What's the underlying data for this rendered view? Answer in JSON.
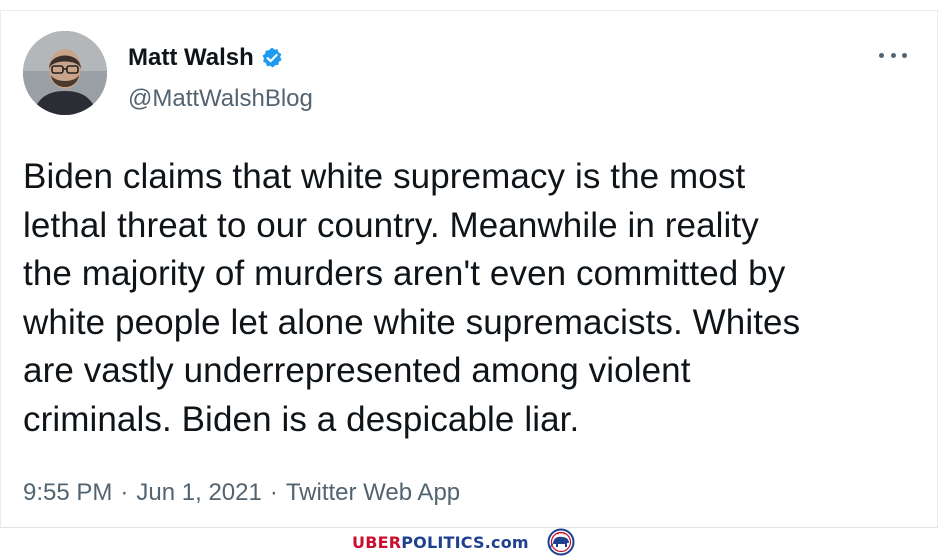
{
  "tweet": {
    "author": {
      "display_name": "Matt Walsh",
      "handle": "@MattWalshBlog",
      "verified": true,
      "avatar_icon": "profile-photo"
    },
    "text": "Biden claims that white supremacy is the most\nlethal threat to our country. Meanwhile in reality\nthe majority of murders aren't even committed by\nwhite people let alone white supremacists. Whites\nare vastly underrepresented among violent\ncriminals. Biden is a despicable liar.",
    "time": "9:55 PM",
    "separator": "·",
    "date": "Jun 1, 2021",
    "source": "Twitter Web App",
    "more_icon": "ellipsis-icon"
  },
  "watermark": {
    "part1": "UBER",
    "part2": "POLITICS",
    "part3": ".com",
    "logo_icon": "elephant-seal-logo"
  },
  "colors": {
    "text_primary": "#0f1419",
    "text_secondary": "#536471",
    "verified_blue": "#1d9bf0",
    "watermark_red": "#c8102e",
    "watermark_blue": "#1f3f8f"
  }
}
